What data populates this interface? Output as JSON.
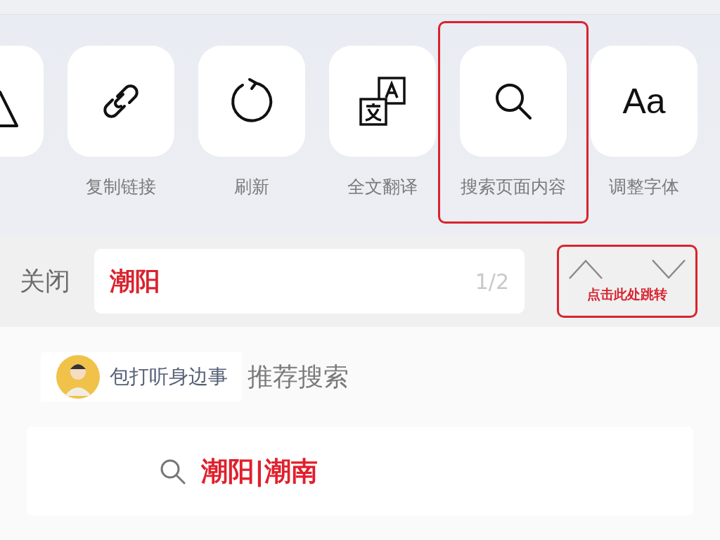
{
  "actions": [
    {
      "kind": "warning",
      "highlighted": false
    },
    {
      "kind": "link",
      "label": "复制链接",
      "highlighted": false
    },
    {
      "kind": "refresh",
      "label": "刷新",
      "highlighted": false
    },
    {
      "kind": "translate",
      "label": "全文翻译",
      "highlighted": false
    },
    {
      "kind": "search",
      "label": "搜索页面内容",
      "highlighted": true
    },
    {
      "kind": "font",
      "glyph": "Aa",
      "label": "调整字体",
      "highlighted": false
    }
  ],
  "find_bar": {
    "close": "关闭",
    "value": "潮阳",
    "count": "1/2",
    "nav": {
      "highlighted": true,
      "annotation": "点击此处跳转"
    }
  },
  "recommend": {
    "source": "包打听身边事",
    "title": "推荐搜索",
    "results": [
      "潮阳|潮南"
    ]
  }
}
